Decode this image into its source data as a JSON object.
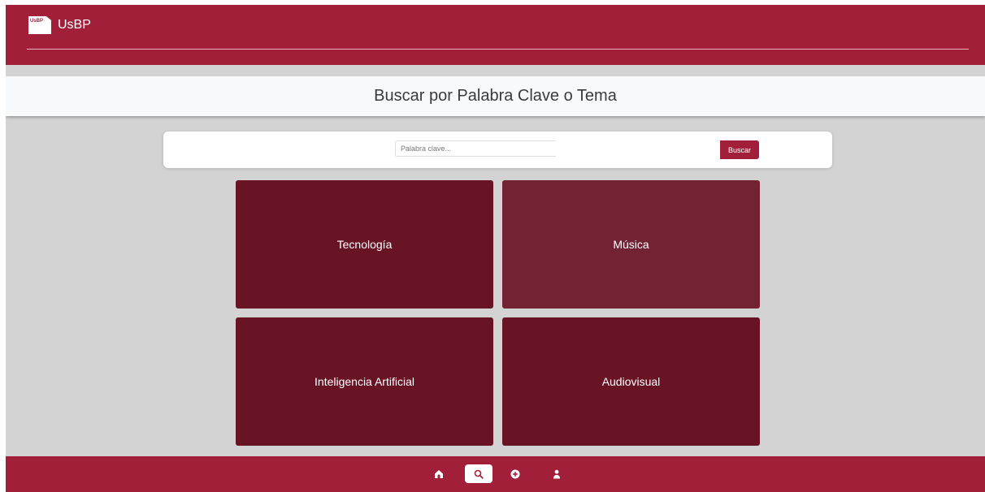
{
  "header": {
    "logo_text": "UsBP",
    "brand_name": "UsBP"
  },
  "banner": {
    "title": "Buscar por Palabra Clave o Tema"
  },
  "search": {
    "placeholder": "Palabra clave...",
    "value": "",
    "button_label": "Buscar"
  },
  "topics": [
    {
      "label": "Tecnología",
      "color": "#691425"
    },
    {
      "label": "Música",
      "color": "#722232"
    },
    {
      "label": "Inteligencia Artificial",
      "color": "#691425"
    },
    {
      "label": "Audiovisual",
      "color": "#691425"
    }
  ],
  "bottom_nav": {
    "items": [
      {
        "icon": "home-icon",
        "active": false
      },
      {
        "icon": "search-icon",
        "active": true
      },
      {
        "icon": "plus-circle-icon",
        "active": false
      },
      {
        "icon": "user-icon",
        "active": false
      }
    ]
  },
  "colors": {
    "brand": "#a11f38",
    "background": "#d3d3d3",
    "tile_dark": "#691425",
    "tile_hover": "#722232"
  }
}
